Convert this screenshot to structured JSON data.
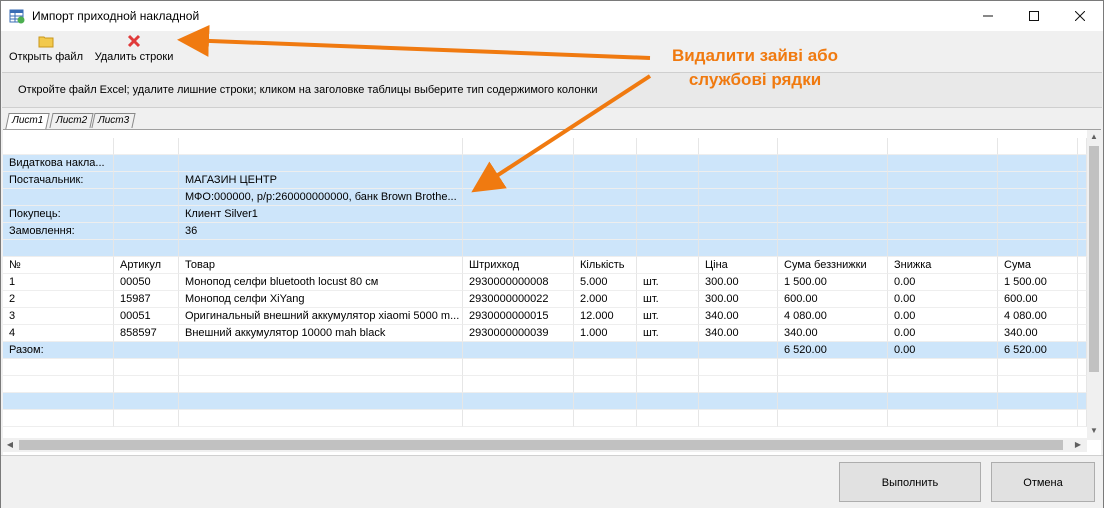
{
  "window": {
    "title": "Импорт приходной накладной"
  },
  "toolbar": {
    "open_file": {
      "label": "Открыть файл",
      "icon": "folder-icon"
    },
    "delete_rows": {
      "label": "Удалить строки",
      "icon": "red-x-icon"
    }
  },
  "hint": "Откройте файл Excel;  удалите лишние строки;  кликом на заголовке таблицы выберите тип содержимого колонки",
  "annotation": {
    "line1": "Видалити зайві або",
    "line2": "службові рядки",
    "color": "#f07a10"
  },
  "tabs": [
    {
      "label": "Лист1",
      "active": true
    },
    {
      "label": "Лист2",
      "active": false
    },
    {
      "label": "Лист3",
      "active": false
    }
  ],
  "grid": {
    "rows": [
      {
        "blue": false,
        "cells": [
          "",
          "",
          "",
          "",
          "",
          "",
          "",
          "",
          "",
          "",
          ""
        ]
      },
      {
        "blue": true,
        "cells": [
          "Видаткова накла...",
          "",
          "",
          "",
          "",
          "",
          "",
          "",
          "",
          "",
          ""
        ]
      },
      {
        "blue": true,
        "cells": [
          "Постачальник:",
          "",
          "МАГАЗИН ЦЕНТР",
          "",
          "",
          "",
          "",
          "",
          "",
          "",
          ""
        ]
      },
      {
        "blue": true,
        "cells": [
          "",
          "",
          "МФО:000000, р/р:260000000000, банк Brown Brothe...",
          "",
          "",
          "",
          "",
          "",
          "",
          "",
          ""
        ]
      },
      {
        "blue": true,
        "cells": [
          "Покупець:",
          "",
          "Клиент Silver1",
          "",
          "",
          "",
          "",
          "",
          "",
          "",
          ""
        ]
      },
      {
        "blue": true,
        "cells": [
          "Замовлення:",
          "",
          "36",
          "",
          "",
          "",
          "",
          "",
          "",
          "",
          ""
        ]
      },
      {
        "blue": true,
        "cells": [
          "",
          "",
          "",
          "",
          "",
          "",
          "",
          "",
          "",
          "",
          ""
        ]
      },
      {
        "blue": false,
        "cells": [
          "№",
          "Артикул",
          "Товар",
          "Штрихкод",
          "Кількість",
          "",
          "Ціна",
          "Сума беззнижки",
          "Знижка",
          "Сума",
          ""
        ]
      },
      {
        "blue": false,
        "cells": [
          "1",
          "00050",
          "Монопод селфи bluetooth locust 80 см",
          "2930000000008",
          "5.000",
          "шт.",
          "300.00",
          "1 500.00",
          "0.00",
          "1 500.00",
          ""
        ]
      },
      {
        "blue": false,
        "cells": [
          "2",
          "15987",
          "Монопод селфи XiYang",
          "2930000000022",
          "2.000",
          "шт.",
          "300.00",
          "600.00",
          "0.00",
          "600.00",
          ""
        ]
      },
      {
        "blue": false,
        "cells": [
          "3",
          "00051",
          "Оригинальный внешний аккумулятор xiaomi 5000 m...",
          "2930000000015",
          "12.000",
          "шт.",
          "340.00",
          "4 080.00",
          "0.00",
          "4 080.00",
          ""
        ]
      },
      {
        "blue": false,
        "cells": [
          "4",
          "858597",
          "Внешний аккумулятор 10000 mah black",
          "2930000000039",
          "1.000",
          "шт.",
          "340.00",
          "340.00",
          "0.00",
          "340.00",
          ""
        ]
      },
      {
        "blue": true,
        "cells": [
          "Разом:",
          "",
          "",
          "",
          "",
          "",
          "",
          "6 520.00",
          "0.00",
          "6 520.00",
          ""
        ]
      },
      {
        "blue": false,
        "cells": [
          "",
          "",
          "",
          "",
          "",
          "",
          "",
          "",
          "",
          "",
          ""
        ]
      },
      {
        "blue": false,
        "cells": [
          "",
          "",
          "",
          "",
          "",
          "",
          "",
          "",
          "",
          "",
          ""
        ]
      },
      {
        "blue": true,
        "cells": [
          "",
          "",
          "",
          "",
          "",
          "",
          "",
          "",
          "",
          "",
          ""
        ]
      },
      {
        "blue": false,
        "cells": [
          "",
          "",
          "",
          "",
          "",
          "",
          "",
          "",
          "",
          "",
          ""
        ]
      }
    ]
  },
  "footer": {
    "execute_label": "Выполнить",
    "cancel_label": "Отмена"
  },
  "colors": {
    "row_highlight": "#cde5fa",
    "delete_icon": "#e03a3a",
    "folder_icon": "#f2c94c"
  }
}
